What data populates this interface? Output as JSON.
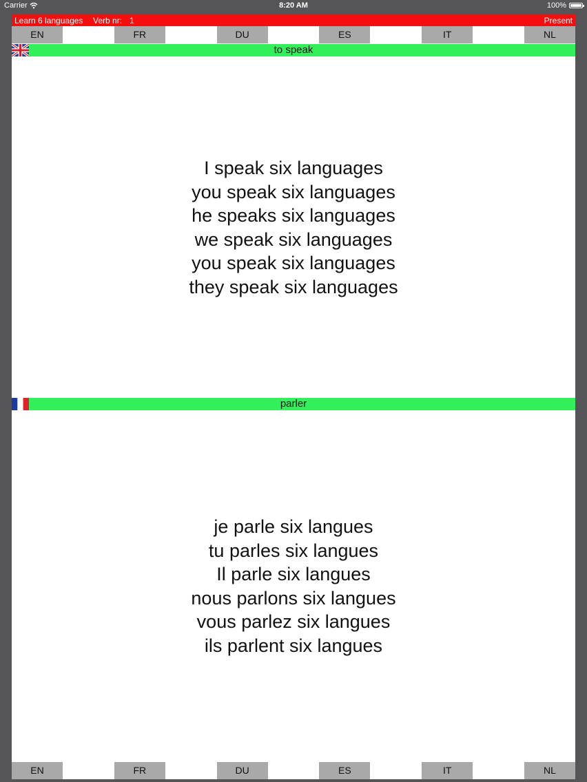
{
  "status_bar": {
    "carrier": "Carrier",
    "time": "8:20 AM",
    "battery": "100%"
  },
  "header": {
    "app_title": "Learn 6 languages",
    "verb_label": "Verb nr:",
    "verb_number": "1",
    "tense": "Present"
  },
  "languages": [
    "EN",
    "FR",
    "DU",
    "ES",
    "IT",
    "NL"
  ],
  "top_panel": {
    "verb": "to speak",
    "flag": "uk-flag-icon",
    "lines": [
      "I speak six languages",
      "you speak six languages",
      "he speaks six languages",
      "we speak six languages",
      "you speak six languages",
      "they speak six languages"
    ]
  },
  "bottom_panel": {
    "verb": "parler",
    "flag": "france-flag-icon",
    "lines": [
      "je parle six langues",
      "tu parles six langues",
      "Il parle six langues",
      "nous parlons six langues",
      "vous parlez six langues",
      "ils parlent six langues"
    ]
  },
  "colors": {
    "title_bar": "#f50e0e",
    "verb_bar": "#33f05a",
    "lang_button": "#a9a9a9",
    "frame": "#555557"
  }
}
